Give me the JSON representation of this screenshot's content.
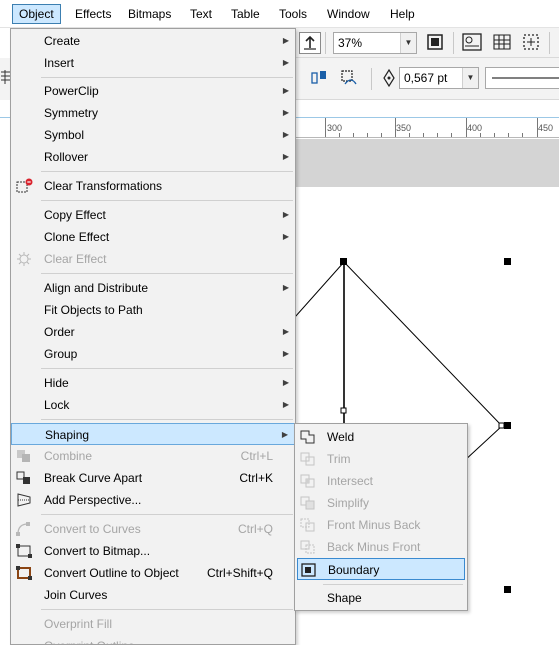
{
  "menubar": {
    "items": [
      {
        "label": "Object"
      },
      {
        "label": "Effects"
      },
      {
        "label": "Bitmaps"
      },
      {
        "label": "Text"
      },
      {
        "label": "Table"
      },
      {
        "label": "Tools"
      },
      {
        "label": "Window"
      },
      {
        "label": "Help"
      }
    ]
  },
  "toolbar": {
    "zoom_value": "37%",
    "outline_width": "0,567 pt"
  },
  "ruler": {
    "labels": [
      "300",
      "350",
      "400",
      "450"
    ]
  },
  "object_menu": {
    "items": [
      {
        "label": "Create",
        "submenu": true
      },
      {
        "label": "Insert",
        "submenu": true
      },
      {
        "label": "PowerClip",
        "submenu": true
      },
      {
        "label": "Symmetry",
        "submenu": true
      },
      {
        "label": "Symbol",
        "submenu": true
      },
      {
        "label": "Rollover",
        "submenu": true
      },
      {
        "label": "Clear Transformations"
      },
      {
        "label": "Copy Effect",
        "submenu": true
      },
      {
        "label": "Clone Effect",
        "submenu": true
      },
      {
        "label": "Clear Effect",
        "disabled": true
      },
      {
        "label": "Align and Distribute",
        "submenu": true
      },
      {
        "label": "Fit Objects to Path"
      },
      {
        "label": "Order",
        "submenu": true
      },
      {
        "label": "Group",
        "submenu": true
      },
      {
        "label": "Hide",
        "submenu": true
      },
      {
        "label": "Lock",
        "submenu": true
      },
      {
        "label": "Shaping",
        "submenu": true,
        "highlighted": true
      },
      {
        "label": "Combine",
        "shortcut": "Ctrl+L",
        "disabled": true
      },
      {
        "label": "Break Curve Apart",
        "shortcut": "Ctrl+K"
      },
      {
        "label": "Add Perspective..."
      },
      {
        "label": "Convert to Curves",
        "shortcut": "Ctrl+Q",
        "disabled": true
      },
      {
        "label": "Convert to Bitmap..."
      },
      {
        "label": "Convert Outline to Object",
        "shortcut": "Ctrl+Shift+Q"
      },
      {
        "label": "Join Curves"
      },
      {
        "label": "Overprint Fill",
        "disabled": true
      },
      {
        "label": "Overprint Outline",
        "disabled": true
      }
    ]
  },
  "shaping_menu": {
    "items": [
      {
        "label": "Weld"
      },
      {
        "label": "Trim",
        "disabled": true
      },
      {
        "label": "Intersect",
        "disabled": true
      },
      {
        "label": "Simplify",
        "disabled": true
      },
      {
        "label": "Front Minus Back",
        "disabled": true
      },
      {
        "label": "Back Minus Front",
        "disabled": true
      },
      {
        "label": "Boundary",
        "highlighted": true
      },
      {
        "label": "Shape"
      }
    ]
  },
  "colors": {
    "highlight_bg": "#cce8ff",
    "highlight_border": "#3a8ad0",
    "menu_bg": "#f2f2f2",
    "disabled_text": "#a5a5a5"
  }
}
